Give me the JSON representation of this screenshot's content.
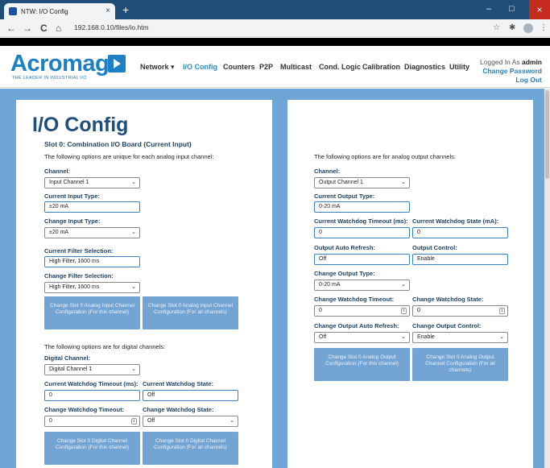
{
  "browser": {
    "tab_title": "NTW: I/O Config",
    "tab_close": "×",
    "new_tab": "+",
    "minimize": "–",
    "maximize": "□",
    "close": "×",
    "back": "←",
    "forward": "→",
    "reload": "C",
    "home": "⌂",
    "url": "192.168.0.10/files/io.htm",
    "star": "☆",
    "extensions": "✱",
    "menu": "⋮"
  },
  "header": {
    "logo_text": "Acromag",
    "logo_tagline": "THE LEADER IN INDUSTRIAL I/O",
    "nav": [
      "Network ▾",
      "I/O Config",
      "Counters",
      "P2P",
      "Multicast",
      "Cond. Logic",
      "Calibration",
      "Diagnostics",
      "Utility"
    ],
    "logged_in_prefix": "Logged In As ",
    "user": "admin",
    "change_password": "Change Password",
    "log_out": "Log Out"
  },
  "page": {
    "title": "I/O Config",
    "slot_heading": "Slot 0: Combination I/O Board (Current Input)"
  },
  "analog_input": {
    "intro": "The following options are unique for each analog input channel:",
    "channel_label": "Channel:",
    "channel_value": "Input Channel 1",
    "current_type_label": "Current Input Type:",
    "current_type_value": "±20 mA",
    "change_type_label": "Change Input Type:",
    "change_type_value": "±20 mA",
    "current_filter_label": "Current Filter Selection:",
    "current_filter_value": "High Filter, 1600 ms",
    "change_filter_label": "Change Filter Selection:",
    "change_filter_value": "High Filter, 1600 ms",
    "btn_this": "Change Slot 0 Analog Input Channel Configuration (For this channel)",
    "btn_all": "Change Slot 0 Analog Input Channel Configuration (For all channels)"
  },
  "digital": {
    "intro": "The following options are for digital channels:",
    "channel_label": "Digital Channel:",
    "channel_value": "Digital Channel 1",
    "wd_timeout_label": "Current Watchdog Timeout (ms):",
    "wd_timeout_value": "0",
    "wd_state_label": "Current Watchdog State:",
    "wd_state_value": "Off",
    "change_timeout_label": "Change Watchdog Timeout:",
    "change_timeout_value": "0",
    "change_state_label": "Change Watchdog State:",
    "change_state_value": "Off",
    "btn_this": "Change Slot 0 Digital Channel Configuration (For this channel)",
    "btn_all": "Change Slot 0 Digital Channel Configuration (For all channels)"
  },
  "analog_output": {
    "intro": "The following options are for analog output channels:",
    "channel_label": "Channel:",
    "channel_value": "Output Channel 1",
    "current_type_label": "Current Output Type:",
    "current_type_value": "0-20 mA",
    "wd_timeout_label": "Current Watchdog Timeout (ms):",
    "wd_timeout_value": "0",
    "wd_state_label": "Current Watchdog State (mA):",
    "wd_state_value": "0",
    "auto_refresh_label": "Output Auto Refresh:",
    "auto_refresh_value": "Off",
    "output_control_label": "Output Control:",
    "output_control_value": "Enable",
    "change_type_label": "Change Output Type:",
    "change_type_value": "0-20 mA",
    "change_wd_timeout_label": "Change Watchdog Timeout:",
    "change_wd_timeout_value": "0",
    "change_wd_state_label": "Change Watchdog State:",
    "change_wd_state_value": "0",
    "change_auto_refresh_label": "Change Output Auto Refresh:",
    "change_auto_refresh_value": "Off",
    "change_output_control_label": "Change Output Control:",
    "change_output_control_value": "Enable",
    "btn_this": "Change Slot 0 Analog Output Configuration (For this channel)",
    "btn_all": "Change Slot 0 Analog Output Channel Configuration (For all channels)"
  },
  "icons": {
    "dropdown": "⌄",
    "spin": "⇕"
  },
  "colors": {
    "title_bar": "#1f4e78",
    "page_background": "#6fa6d8",
    "button": "#74a4d3",
    "heading": "#1f4e79",
    "brand": "#1d7fc4"
  }
}
